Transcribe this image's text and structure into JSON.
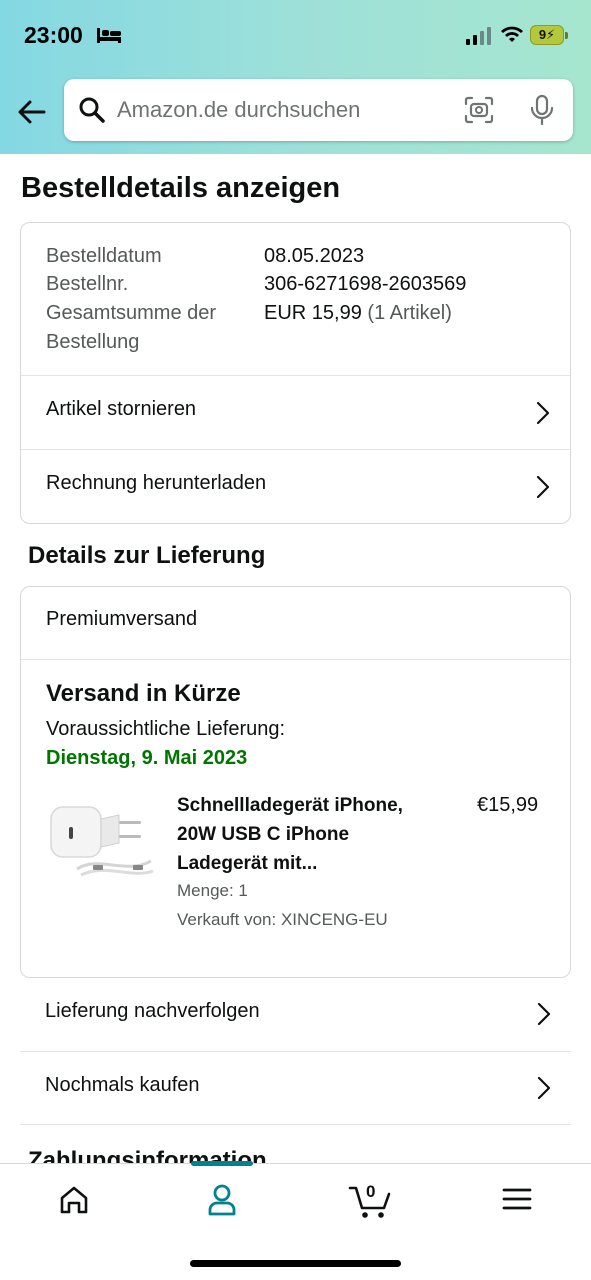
{
  "status_bar": {
    "time": "23:00",
    "battery": "9⚡"
  },
  "search": {
    "placeholder": "Amazon.de durchsuchen"
  },
  "page": {
    "title": "Bestelldetails anzeigen"
  },
  "order_summary": {
    "date_label": "Bestelldatum",
    "date_value": "08.05.2023",
    "number_label": "Bestellnr.",
    "number_value": "306-6271698-2603569",
    "total_label_1": "Gesamtsumme der",
    "total_label_2": "Bestellung",
    "total_value": "EUR 15,99",
    "total_items": "(1 Artikel)",
    "actions": [
      {
        "label": "Artikel stornieren"
      },
      {
        "label": "Rechnung herunterladen"
      }
    ]
  },
  "delivery": {
    "section_title": "Details zur Lieferung",
    "shipping_type": "Premiumversand",
    "heading": "Versand in Kürze",
    "eta_label": "Voraussichtliche Lieferung:",
    "eta_date": "Dienstag, 9. Mai 2023",
    "eta_color": "#007600",
    "product": {
      "title": "Schnellladegerät iPhone, 20W USB C iPhone Ladegerät mit...",
      "price": "€15,99",
      "quantity": "Menge: 1",
      "seller": "Verkauft von: XINCENG-EU"
    },
    "actions": [
      {
        "label": "Lieferung nachverfolgen"
      },
      {
        "label": "Nochmals kaufen"
      }
    ]
  },
  "next_section": {
    "title": "Zahlungsinformation"
  },
  "bottom_nav": {
    "items": [
      "home-icon",
      "account-icon",
      "cart-icon",
      "menu-icon"
    ],
    "active": "account",
    "cart_count": "0",
    "accent_color": "#00838f"
  }
}
